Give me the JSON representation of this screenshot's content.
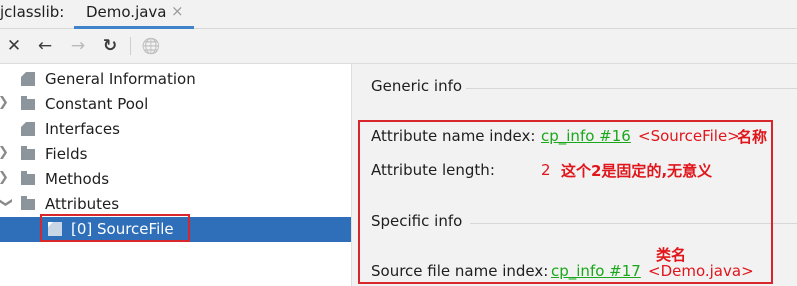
{
  "window": {
    "tool_name": "jclasslib:",
    "tab_label": "Demo.java",
    "tab_close_glyph": "×"
  },
  "toolbar": {
    "buttons": [
      {
        "icon": "close-icon",
        "glyph": "✕"
      },
      {
        "icon": "back-arrow-icon",
        "glyph": "←"
      },
      {
        "icon": "forward-arrow-icon",
        "glyph": "→"
      },
      {
        "icon": "refresh-icon",
        "glyph": "↻"
      },
      {
        "icon": "globe-icon",
        "glyph": "🌐"
      }
    ]
  },
  "tree": {
    "items": [
      {
        "label": "General Information",
        "icon": "page-icon",
        "expandable": false
      },
      {
        "label": "Constant Pool",
        "icon": "folder-icon",
        "expandable": true
      },
      {
        "label": "Interfaces",
        "icon": "page-icon",
        "expandable": false
      },
      {
        "label": "Fields",
        "icon": "folder-icon",
        "expandable": true
      },
      {
        "label": "Methods",
        "icon": "folder-icon",
        "expandable": true
      },
      {
        "label": "Attributes",
        "icon": "folder-icon",
        "expandable": true,
        "expanded": true
      },
      {
        "label": "[0] SourceFile",
        "icon": "page-icon",
        "selected": true
      }
    ]
  },
  "details": {
    "generic_title": "Generic info",
    "attr_name_label": "Attribute name index:",
    "attr_name_link": "cp_info #16",
    "attr_name_value": "<SourceFile>",
    "attr_name_annotation": "名称",
    "attr_length_label": "Attribute length:",
    "attr_length_value": "2",
    "attr_length_annotation": "这个2是固定的,无意义",
    "specific_title": "Specific info",
    "class_name_annotation": "类名",
    "source_label": "Source file name index:",
    "source_link": "cp_info #17",
    "source_value": "<Demo.java>"
  },
  "colors": {
    "selection": "#2f6eb8",
    "link": "#1aa81a",
    "annotation_red": "#e0161b",
    "tab_underline": "#4083c9"
  }
}
